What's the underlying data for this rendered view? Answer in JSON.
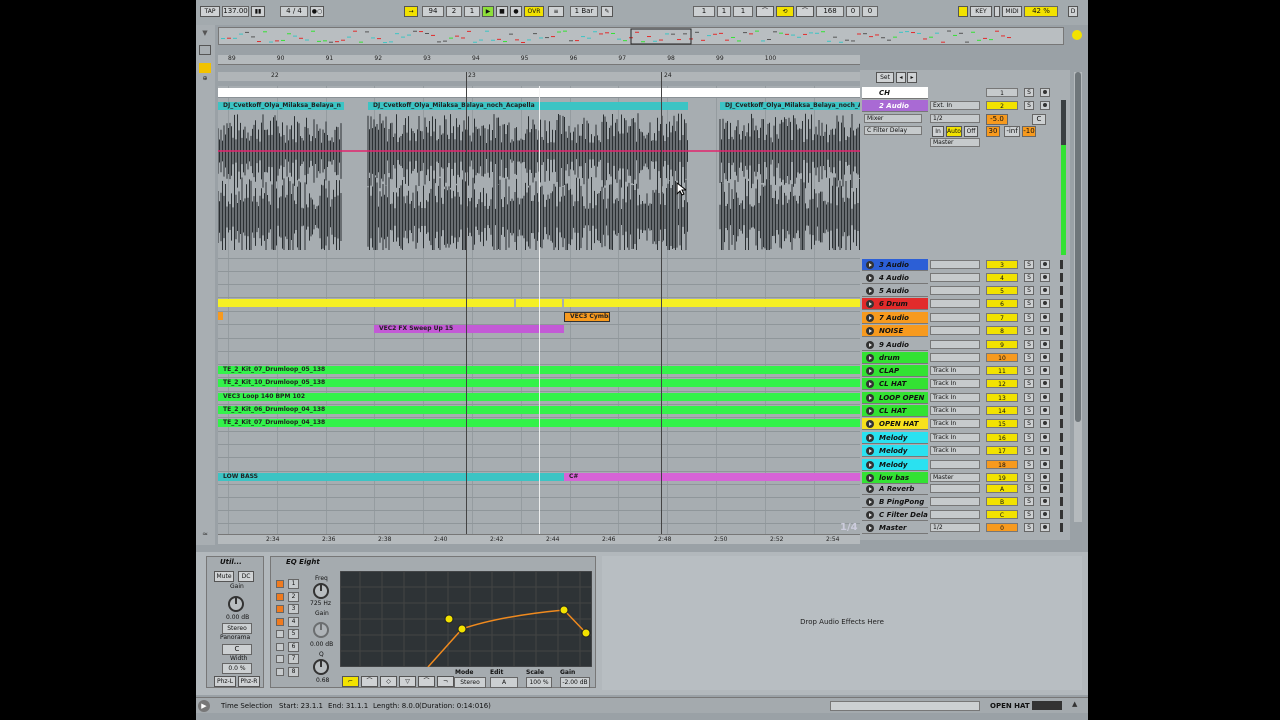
{
  "transport": {
    "tap": "TAP",
    "bpm": "137.00",
    "sig": "4 / 4",
    "position": [
      "94",
      "2",
      "1"
    ],
    "ovr": "OVR",
    "quantize": "1 Bar",
    "loop_start": [
      "1",
      "1",
      "1"
    ],
    "loop_len": [
      "168",
      "0",
      "0"
    ],
    "key": "KEY",
    "midi": "MIDI",
    "cpu": "42 %",
    "d": "D"
  },
  "ruler": {
    "bars": [
      "89",
      "90",
      "91",
      "92",
      "93",
      "94",
      "95",
      "96",
      "97",
      "98",
      "99",
      "100"
    ],
    "loc": [
      "22",
      "23",
      "24"
    ],
    "times": [
      "2:34",
      "2:36",
      "2:38",
      "2:40",
      "2:42",
      "2:44",
      "2:46",
      "2:48",
      "2:50",
      "2:52",
      "2:54"
    ]
  },
  "clips": {
    "audio2": [
      "DJ_Cvetkoff_Olya_Milaksa_Belaya_n",
      "DJ_Cvetkoff_Olya_Milaksa_Belaya_noch_Acapella",
      "DJ_Cvetkoff_Olya_Milaksa_Belaya_noch_A"
    ],
    "cymbal": "VEC3 Cymbal",
    "sweep": "VEC2 FX Sweep Up 15",
    "clap": "TE_2_Kit_07_Drumloop_05_138",
    "clhat": "TE_2_Kit_10_Drumloop_05_138",
    "loopopen": "VEC3 Loop 140 BPM 102",
    "clhat2": "TE_2_Kit_06_Drumloop_04_138",
    "openhat": "TE_2_Kit_07_Drumloop_04_138",
    "lowbass": "LOW BASS",
    "lowbass2": "C#"
  },
  "mixer_head": {
    "set": "Set",
    "ch": "CH",
    "ch_num": "1",
    "audio2": "2 Audio",
    "ext_in": "Ext. In",
    "one_two": "1/2",
    "mixer": "Mixer",
    "cfilter": "C Filter Delay",
    "master": "Master",
    "in": "In",
    "auto": "Auto",
    "off": "Off",
    "num2": "2",
    "vol": "-5.0",
    "pan": "C",
    "v30": "30",
    "vinf": "-inf",
    "v10": "-10"
  },
  "tracks": [
    {
      "name": "3 Audio",
      "num": "3",
      "color": "#2c5fd6",
      "io": ""
    },
    {
      "name": "4 Audio",
      "num": "4",
      "color": "",
      "io": ""
    },
    {
      "name": "5 Audio",
      "num": "5",
      "color": "",
      "io": ""
    },
    {
      "name": "6 Drum Rack",
      "num": "6",
      "color": "#e22b2b",
      "io": ""
    },
    {
      "name": "7 Audio",
      "num": "7",
      "color": "#f79a1e",
      "io": ""
    },
    {
      "name": "NOISE",
      "num": "8",
      "color": "#f79a1e",
      "io": ""
    },
    {
      "name": "9 Audio",
      "num": "9",
      "color": "",
      "io": ""
    },
    {
      "name": "drum",
      "num": "10",
      "color": "#33e233",
      "io": ""
    },
    {
      "name": "CLAP",
      "num": "11",
      "color": "#33e233",
      "io": "Track In"
    },
    {
      "name": "CL HAT",
      "num": "12",
      "color": "#33e233",
      "io": "Track In"
    },
    {
      "name": "LOOP OPEN",
      "num": "13",
      "color": "#33e233",
      "io": "Track In"
    },
    {
      "name": "CL HAT",
      "num": "14",
      "color": "#33e233",
      "io": "Track In"
    },
    {
      "name": "OPEN HAT",
      "num": "15",
      "color": "#f7e11e",
      "io": "Track In"
    },
    {
      "name": "Melody",
      "num": "16",
      "color": "#2ae1f0",
      "io": "Track In"
    },
    {
      "name": "Melody",
      "num": "17",
      "color": "#2ae1f0",
      "io": "Track In"
    },
    {
      "name": "Melody Grou",
      "num": "18",
      "color": "#2ae1f0",
      "io": ""
    },
    {
      "name": "low bas",
      "num": "19",
      "color": "#33e233",
      "io": "Master"
    },
    {
      "name": "A Reverb",
      "num": "A",
      "color": "",
      "io": ""
    },
    {
      "name": "B PingPong",
      "num": "B",
      "color": "",
      "io": ""
    },
    {
      "name": "C Filter Dela",
      "num": "C",
      "color": "",
      "io": ""
    },
    {
      "name": "Master",
      "num": "0",
      "color": "",
      "io": "1/2"
    }
  ],
  "zoom": "1/4",
  "devices": {
    "util": {
      "title": "Util...",
      "mute": "Mute",
      "dc": "DC",
      "gain": "Gain",
      "gain_val": "0.00 dB",
      "stereo": "Stereo",
      "panorama": "Panorama",
      "pan_val": "C",
      "width": "Width",
      "width_val": "0.0 %",
      "phzl": "Phz-L",
      "phzr": "Phz-R"
    },
    "eq": {
      "title": "EQ Eight",
      "freq": "Freq",
      "freq_val": "725 Hz",
      "gain": "Gain",
      "gain_val": "0.00 dB",
      "q": "Q",
      "q_val": "0.68",
      "mode": "Mode",
      "edit": "Edit",
      "scale": "Scale",
      "gain2": "Gain",
      "mode_val": "Stereo",
      "edit_val": "A",
      "scale_val": "100 %",
      "gain2_val": "-2.00 dB",
      "bands": [
        "1",
        "2",
        "3",
        "4",
        "5",
        "6",
        "7",
        "8"
      ]
    },
    "drop": "Drop Audio Effects Here"
  },
  "status": {
    "label": "Time Selection",
    "start": "Start: 23.1.1",
    "end": "End: 31.1.1",
    "length": "Length: 8.0.0",
    "duration": "(Duration: 0:14:016)",
    "track": "OPEN HAT"
  },
  "colors": {
    "accent": "#f2c200",
    "green": "#33e233",
    "cyan": "#2ae1f0",
    "orange": "#f79a1e"
  }
}
